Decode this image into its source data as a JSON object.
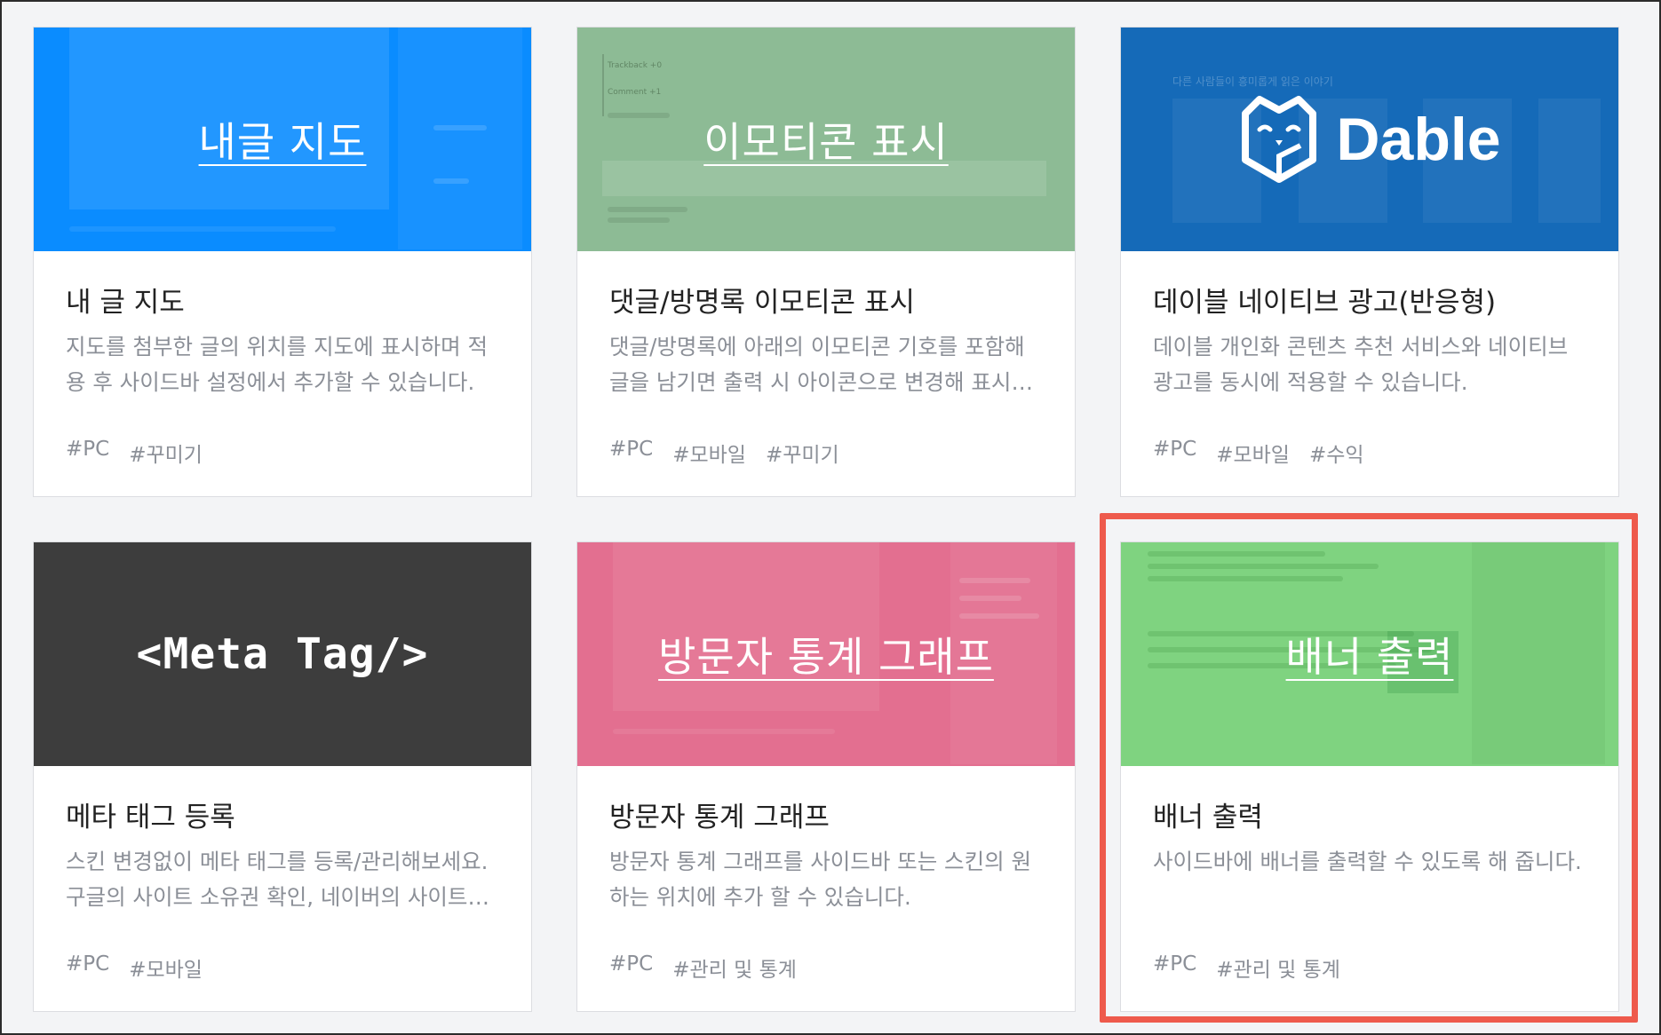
{
  "plugins": [
    {
      "thumb_title": "내글 지도",
      "title": "내 글 지도",
      "description": "지도를 첨부한 글의 위치를 지도에 표시하며 적용 후 사이드바 설정에서 추가할 수 있습니다.",
      "tags": [
        "#PC",
        "#꾸미기"
      ],
      "thumb_color": "#0a8cff"
    },
    {
      "thumb_title": "이모티콘 표시",
      "title": "댓글/방명록 이모티콘 표시",
      "description": "댓글/방명록에 아래의 이모티콘 기호를 포함해 글을 남기면 출력 시 아이콘으로 변경해 표시…",
      "tags": [
        "#PC",
        "#모바일",
        "#꾸미기"
      ],
      "thumb_color": "#8dbb95",
      "ghost_texts": [
        "Trackback +0",
        "Comment +1"
      ]
    },
    {
      "thumb_logo": "Dable",
      "title": "데이블 네이티브 광고(반응형)",
      "description": "데이블 개인화 콘텐츠 추천 서비스와 네이티브 광고를 동시에 적용할 수 있습니다.",
      "tags": [
        "#PC",
        "#모바일",
        "#수익"
      ],
      "thumb_color": "#156ab8",
      "ghost_texts": [
        "다른 사람들이 흥미롭게 읽은 이야기"
      ]
    },
    {
      "thumb_code": "<Meta Tag/>",
      "title": "메타 태그 등록",
      "description": "스킨 변경없이 메타 태그를 등록/관리해보세요. 구글의 사이트 소유권 확인, 네이버의 사이트…",
      "tags": [
        "#PC",
        "#모바일"
      ],
      "thumb_color": "#3d3d3d"
    },
    {
      "thumb_title": "방문자 통계 그래프",
      "title": "방문자 통계 그래프",
      "description": "방문자 통계 그래프를 사이드바 또는 스킨의 원하는 위치에 추가 할 수 있습니다.",
      "tags": [
        "#PC",
        "#관리 및 통계"
      ],
      "thumb_color": "#e36f90"
    },
    {
      "thumb_title": "배너 출력",
      "title": "배너 출력",
      "description": "사이드바에 배너를 출력할 수 있도록 해 줍니다.",
      "tags": [
        "#PC",
        "#관리 및 통계"
      ],
      "thumb_color": "#7fd380"
    }
  ]
}
